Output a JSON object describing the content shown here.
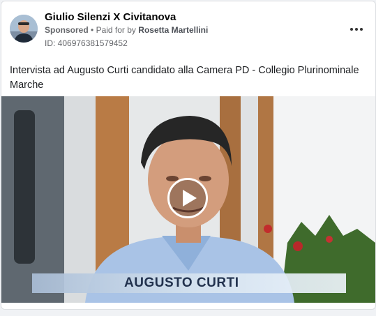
{
  "post": {
    "page_name": "Giulio Silenzi X Civitanova",
    "sponsored_label": "Sponsored",
    "separator": "•",
    "paid_for_prefix": "Paid for by",
    "payer": "Rosetta Martellini",
    "ad_id": "ID: 406976381579452",
    "text": "Intervista ad Augusto Curti candidato alla Camera PD - Collegio Plurinominale Marche"
  },
  "video": {
    "lower_third_name": "AUGUSTO CURTI"
  },
  "icons": {
    "more": "more-horizontal-icon",
    "play": "play-icon"
  },
  "colors": {
    "text_primary": "#050505",
    "text_secondary": "#65676b",
    "card_bg": "#ffffff",
    "page_bg": "#f0f2f5",
    "caption_text": "#22324e"
  }
}
